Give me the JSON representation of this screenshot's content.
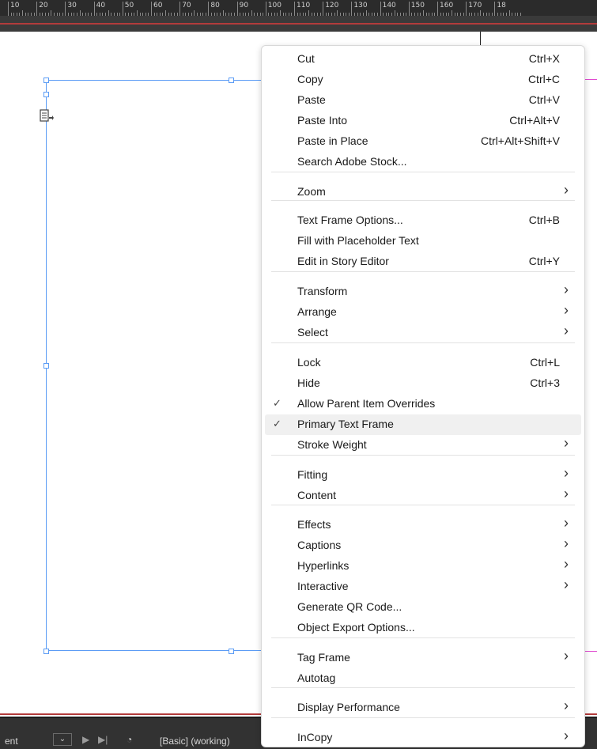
{
  "ruler": {
    "labels": [
      "10",
      "20",
      "30",
      "40",
      "50",
      "60",
      "70",
      "80",
      "90",
      "100",
      "110",
      "120",
      "130",
      "140",
      "150",
      "160",
      "170",
      "18"
    ]
  },
  "status": {
    "left_text": "ent",
    "dropdown": "⌄",
    "preflight_text": "[Basic] (working)"
  },
  "menu": {
    "groups": [
      [
        {
          "label": "Cut",
          "shortcut": "Ctrl+X"
        },
        {
          "label": "Copy",
          "shortcut": "Ctrl+C"
        },
        {
          "label": "Paste",
          "shortcut": "Ctrl+V"
        },
        {
          "label": "Paste Into",
          "shortcut": "Ctrl+Alt+V"
        },
        {
          "label": "Paste in Place",
          "shortcut": "Ctrl+Alt+Shift+V"
        },
        {
          "label": "Search Adobe Stock...",
          "shortcut": ""
        }
      ],
      [
        {
          "label": "Zoom",
          "submenu": true
        }
      ],
      [
        {
          "label": "Text Frame Options...",
          "shortcut": "Ctrl+B"
        },
        {
          "label": "Fill with Placeholder Text",
          "shortcut": ""
        },
        {
          "label": "Edit in Story Editor",
          "shortcut": "Ctrl+Y"
        }
      ],
      [
        {
          "label": "Transform",
          "submenu": true
        },
        {
          "label": "Arrange",
          "submenu": true
        },
        {
          "label": "Select",
          "submenu": true
        }
      ],
      [
        {
          "label": "Lock",
          "shortcut": "Ctrl+L"
        },
        {
          "label": "Hide",
          "shortcut": "Ctrl+3"
        },
        {
          "label": "Allow Parent Item Overrides",
          "checked": true
        },
        {
          "label": "Primary Text Frame",
          "checked": true,
          "highlighted": true
        },
        {
          "label": "Stroke Weight",
          "submenu": true
        }
      ],
      [
        {
          "label": "Fitting",
          "submenu": true
        },
        {
          "label": "Content",
          "submenu": true
        }
      ],
      [
        {
          "label": "Effects",
          "submenu": true
        },
        {
          "label": "Captions",
          "submenu": true
        },
        {
          "label": "Hyperlinks",
          "submenu": true
        },
        {
          "label": "Interactive",
          "submenu": true
        },
        {
          "label": "Generate QR Code...",
          "shortcut": ""
        },
        {
          "label": "Object Export Options...",
          "shortcut": ""
        }
      ],
      [
        {
          "label": "Tag Frame",
          "submenu": true
        },
        {
          "label": "Autotag",
          "shortcut": ""
        }
      ],
      [
        {
          "label": "Display Performance",
          "submenu": true
        }
      ],
      [
        {
          "label": "InCopy",
          "submenu": true
        }
      ]
    ]
  }
}
